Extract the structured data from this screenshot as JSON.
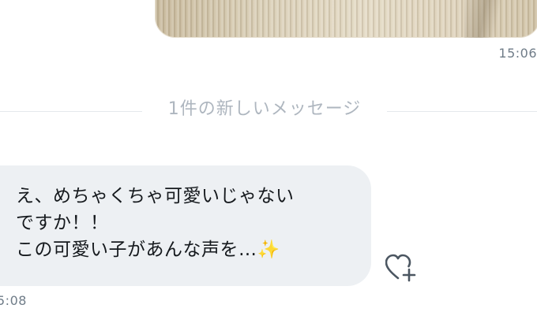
{
  "outgoing": {
    "image_alt": "shared-photo",
    "time": "15:06"
  },
  "divider": {
    "label": "1件の新しいメッセージ"
  },
  "incoming": {
    "lines": [
      "え、めちゃくちゃ可愛いじゃない",
      "ですか！！",
      "この可愛い子があんな声を…"
    ],
    "emoji": "✨",
    "time": "5:08",
    "react_icon": "heart-plus-icon"
  },
  "colors": {
    "bubble": "#edf0f3",
    "text": "#15191d",
    "meta": "#6f7c88",
    "divider_text": "#aeb6bf"
  }
}
